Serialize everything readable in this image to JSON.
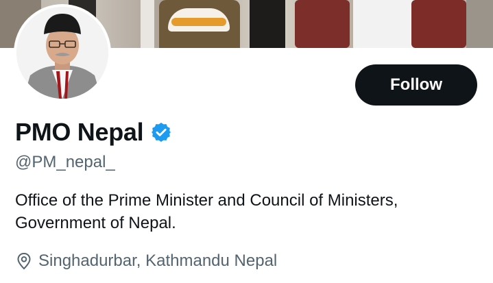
{
  "profile": {
    "name": "PMO Nepal",
    "handle": "@PM_nepal_",
    "bio_line1": "Office of the Prime Minister and Council of Ministers,",
    "bio_line2": "Government of Nepal.",
    "location": "Singhadurbar, Kathmandu Nepal",
    "verified": true,
    "verified_icon": "verified-badge-icon",
    "location_icon": "location-pin-icon"
  },
  "actions": {
    "follow_label": "Follow"
  },
  "colors": {
    "button_bg": "#0f1419",
    "button_text": "#ffffff",
    "verified": "#1d9bf0",
    "secondary_text": "#536471"
  }
}
